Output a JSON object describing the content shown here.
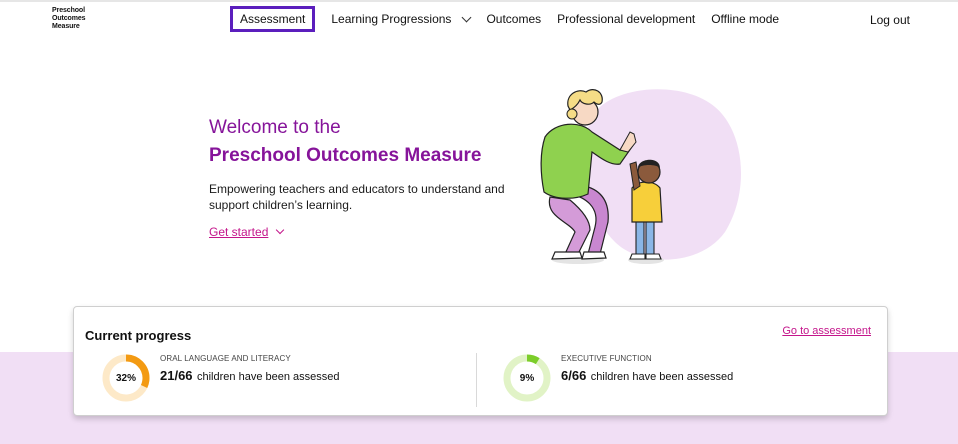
{
  "header": {
    "logo_lines": [
      "Preschool",
      "Outcomes",
      "Measure"
    ],
    "nav": [
      {
        "label": "Assessment",
        "active": true
      },
      {
        "label": "Learning Progressions",
        "has_dropdown": true
      },
      {
        "label": "Outcomes"
      },
      {
        "label": "Professional development"
      },
      {
        "label": "Offline mode"
      }
    ],
    "logout": "Log out"
  },
  "hero": {
    "title_line1": "Welcome to the",
    "title_line2": "Preschool Outcomes Measure",
    "description": "Empowering teachers and educators to understand and support children’s learning.",
    "cta": "Get started",
    "illustration": "adult-and-child-high-five-illustration"
  },
  "progress": {
    "title": "Current progress",
    "link": "Go to assessment",
    "metrics": [
      {
        "category": "ORAL LANGUAGE AND LITERACY",
        "percent_label": "32%",
        "percent": 32,
        "count": "21/66",
        "suffix": "children have been assessed",
        "color": "#f39a12",
        "track_color": "#fde9c8"
      },
      {
        "category": "EXECUTIVE FUNCTION",
        "percent_label": "9%",
        "percent": 9,
        "count": "6/66",
        "suffix": "children have been assessed",
        "color": "#7ccd2a",
        "track_color": "#e1f3c6"
      }
    ]
  },
  "colors": {
    "brand_purple": "#86149a",
    "link_pink": "#c4158b",
    "active_outline": "#5b1ebd",
    "band": "#f1dff5"
  }
}
